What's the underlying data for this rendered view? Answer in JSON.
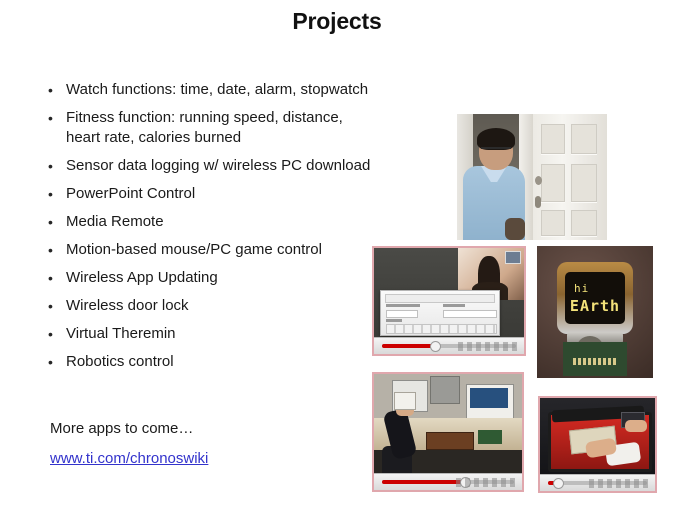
{
  "slide": {
    "title": "Projects",
    "background_color": "#ffffff",
    "text_color": "#1a1a1a"
  },
  "bullets": [
    {
      "marker": "•",
      "text": "Watch functions: time, date, alarm, stopwatch"
    },
    {
      "marker": "•",
      "text": "Fitness function: running speed, distance,\nheart rate, calories burned"
    },
    {
      "marker": "•",
      "text": "Sensor data logging w/ wireless PC download"
    },
    {
      "marker": "•",
      "text": "PowerPoint Control"
    },
    {
      "marker": "•",
      "text": "Media Remote"
    },
    {
      "marker": "•",
      "text": "Motion-based mouse/PC game control"
    },
    {
      "marker": "•",
      "text": "Wireless App Updating"
    },
    {
      "marker": "•",
      "text": "Wireless door lock"
    },
    {
      "marker": "•",
      "text": "Virtual Theremin"
    },
    {
      "marker": "•",
      "text": "Robotics control"
    }
  ],
  "footer": {
    "more_apps": "More apps to come…",
    "link_text": "www.ti.com/chronoswiki",
    "link_color": "#3333cc"
  },
  "media": {
    "photo_door": {
      "caption": "Man in blue shirt standing at a white panel door (wireless door lock demo)"
    },
    "video_ppt": {
      "caption": "Video: PowerPoint control demo with settings dialog over a presentation screen"
    },
    "photo_watch": {
      "caption": "Close-up of eZ430-Chronos watch LCD on a circuit board",
      "lcd_line1": "hi",
      "lcd_line2": "EArth"
    },
    "video_lab": {
      "caption": "Video: lab desk with monitors, laptop and development boards"
    },
    "video_robot": {
      "caption": "Video: hands operating a red robotics machine"
    }
  }
}
